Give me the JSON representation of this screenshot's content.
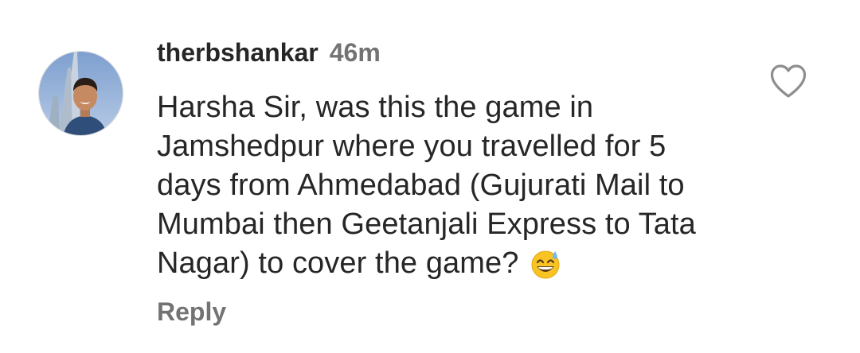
{
  "comment": {
    "username": "therbshankar",
    "timestamp": "46m",
    "text": "Harsha Sir, was this the game in Jamshedpur where you travelled for 5 days from Ahmedabad (Gujurati Mail to Mumbai then Geetanjali Express to Tata Nagar) to cover the game?",
    "emoji_icon": "grinning-face-with-sweat-emoji",
    "reply_label": "Reply",
    "like_icon": "heart-outline-icon"
  },
  "colors": {
    "text_primary": "#262626",
    "text_secondary": "#737373",
    "background": "#ffffff"
  }
}
